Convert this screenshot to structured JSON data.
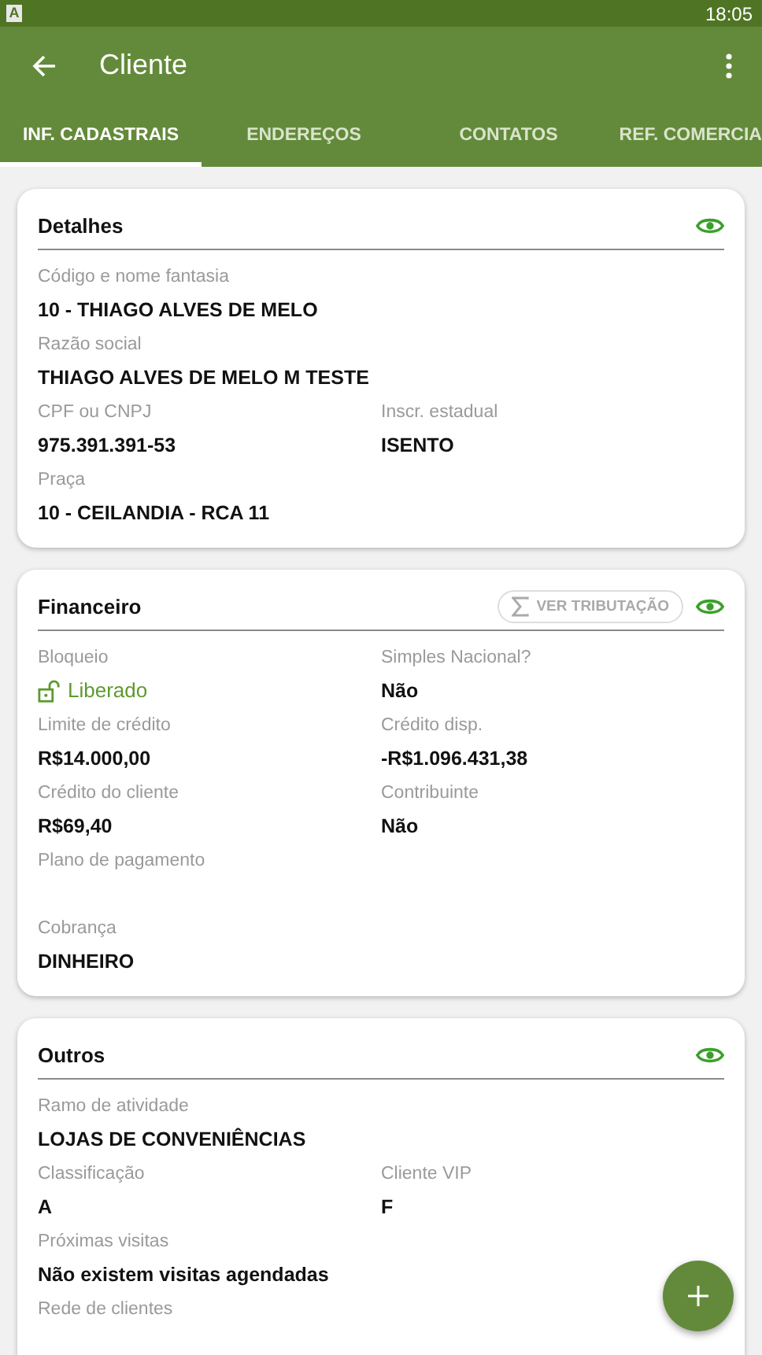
{
  "status_bar": {
    "app_letter": "A",
    "time": "18:05"
  },
  "app_bar": {
    "title": "Cliente"
  },
  "tabs": [
    {
      "label": "INF. CADASTRAIS",
      "selected": true
    },
    {
      "label": "ENDEREÇOS",
      "selected": false
    },
    {
      "label": "CONTATOS",
      "selected": false
    },
    {
      "label": "REF. COMERCIA",
      "selected": false
    }
  ],
  "cards": [
    {
      "title": "Detalhes",
      "rows": [
        [
          {
            "label": "Código e nome fantasia",
            "value": "10 - THIAGO ALVES DE MELO",
            "kind": "text"
          }
        ],
        [
          {
            "label": "Razão social",
            "value": "THIAGO ALVES DE MELO M TESTE",
            "kind": "text"
          }
        ],
        [
          {
            "label": "CPF ou CNPJ",
            "value": "975.391.391-53",
            "kind": "text"
          },
          {
            "label": "Inscr. estadual",
            "value": "ISENTO",
            "kind": "text"
          }
        ],
        [
          {
            "label": "Praça",
            "value": "10 - CEILANDIA - RCA 11",
            "kind": "text"
          }
        ]
      ]
    },
    {
      "title": "Financeiro",
      "action": "VER TRIBUTAÇÃO",
      "rows": [
        [
          {
            "label": "Bloqueio",
            "value": "Liberado",
            "kind": "status"
          },
          {
            "label": "Simples Nacional?",
            "value": "Não",
            "kind": "text"
          }
        ],
        [
          {
            "label": "Limite de crédito",
            "value": "R$14.000,00",
            "kind": "text"
          },
          {
            "label": "Crédito disp.",
            "value": "-R$1.096.431,38",
            "kind": "text"
          }
        ],
        [
          {
            "label": "Crédito do cliente",
            "value": "R$69,40",
            "kind": "text"
          },
          {
            "label": "Contribuinte",
            "value": "Não",
            "kind": "text"
          }
        ],
        [
          {
            "label": "Plano de pagamento"
          }
        ],
        [
          {
            "label": "Cobrança",
            "value": "DINHEIRO",
            "kind": "text"
          }
        ]
      ]
    },
    {
      "title": "Outros",
      "rows": [
        [
          {
            "label": "Ramo de atividade",
            "value": "LOJAS DE CONVENIÊNCIAS",
            "kind": "text"
          }
        ],
        [
          {
            "label": "Classificação",
            "value": "A",
            "kind": "text"
          },
          {
            "label": "Cliente VIP",
            "value": "F",
            "kind": "text"
          }
        ],
        [
          {
            "label": "Próximas visitas",
            "value": "Não existem visitas agendadas",
            "kind": "text"
          }
        ],
        [
          {
            "label": "Rede de clientes"
          }
        ]
      ]
    }
  ]
}
